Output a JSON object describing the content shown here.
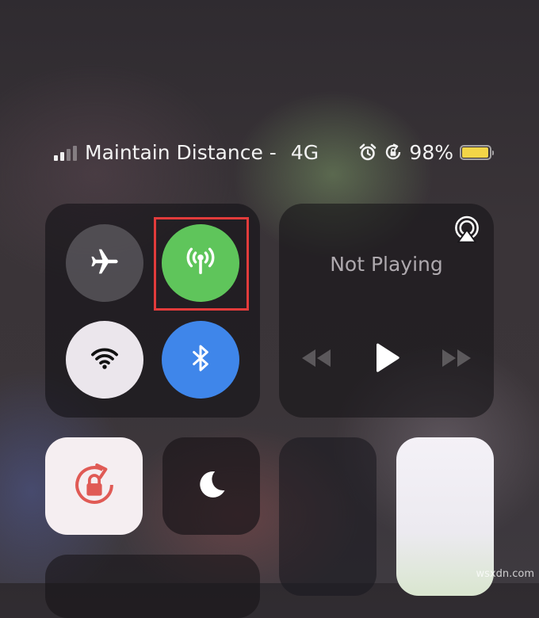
{
  "status_bar": {
    "carrier": "Maintain Distance -",
    "network_type": "4G",
    "battery_percent_label": "98%",
    "battery_level": 0.98,
    "signal_bars_total": 4,
    "signal_bars_active": 2,
    "icons": [
      "alarm-icon",
      "rotation-lock-icon",
      "battery-icon"
    ]
  },
  "connectivity": {
    "airplane_mode": {
      "icon": "airplane-icon",
      "on": false
    },
    "cellular_data": {
      "icon": "cellular-antenna-icon",
      "on": true,
      "highlighted": true
    },
    "wifi": {
      "icon": "wifi-icon",
      "on": false
    },
    "bluetooth": {
      "icon": "bluetooth-icon",
      "on": true
    }
  },
  "now_playing": {
    "title": "Not Playing",
    "icons": [
      "airplay-icon",
      "previous-track-icon",
      "play-icon",
      "next-track-icon"
    ]
  },
  "tiles": {
    "rotation_lock": {
      "icon": "rotation-lock-icon",
      "on": true
    },
    "do_not_disturb": {
      "icon": "moon-icon",
      "on": false
    },
    "brightness_level": 0,
    "volume_level": 1
  },
  "watermark": "wsxdn.com",
  "colors": {
    "cellular_on": "#5fc55b",
    "bluetooth_on": "#3f86ea",
    "highlight_box": "#e23b3b",
    "battery_fill": "#f3d547",
    "rotation_lock_red": "#e05a55"
  }
}
